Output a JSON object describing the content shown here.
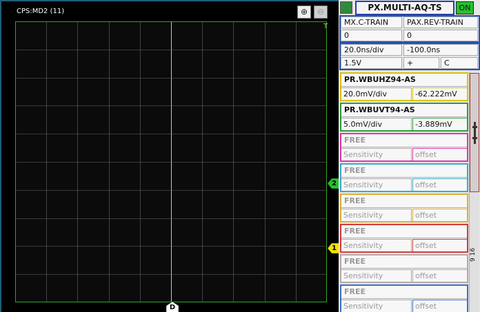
{
  "scope": {
    "title": "CPS:MD2 (11)",
    "trigger_label": "T",
    "zoom_in_icon": "zoom-in-icon",
    "zoom_out_icon": "zoom-out-icon",
    "markers": [
      {
        "label": "2",
        "color": "#22c32b"
      },
      {
        "label": "1",
        "color": "#f0e000"
      }
    ],
    "delay_marker": "D",
    "grid_color": "#2fa32f",
    "inner_grid_color": "#6a6a6a",
    "center_line_color": "#c9c9c9"
  },
  "panel": {
    "title": "PX.MULTI-AQ-TS",
    "status": "ON",
    "status_color": "#22c32b",
    "trigger_a": "MX.C-TRAIN",
    "trigger_b": "PAX.REV-TRAIN",
    "count_a": "0",
    "count_b": "0",
    "timebase": "20.0ns/div",
    "delay": "-100.0ns",
    "trig_level": "1.5V",
    "trig_slope": "+",
    "trig_coupling": "C",
    "page_indicator": "9 16"
  },
  "channels": [
    {
      "name": "PR.WBUHZ94-AS",
      "sensitivity": "20.0mV/div",
      "offset": "-62.222mV",
      "color": "#e0c000",
      "active": true
    },
    {
      "name": "PR.WBUVT94-AS",
      "sensitivity": "5.0mV/div",
      "offset": "-3.889mV",
      "color": "#2f9e3a",
      "active": true
    },
    {
      "name": "FREE",
      "sensitivity": "Sensitivity",
      "offset": "offset",
      "color": "#d93aa8",
      "active": false
    },
    {
      "name": "FREE",
      "sensitivity": "Sensitivity",
      "offset": "offset",
      "color": "#3fa9c9",
      "active": false
    },
    {
      "name": "FREE",
      "sensitivity": "Sensitivity",
      "offset": "offset",
      "color": "#e0b030",
      "active": false
    },
    {
      "name": "FREE",
      "sensitivity": "Sensitivity",
      "offset": "offset",
      "color": "#d23b3b",
      "active": false
    },
    {
      "name": "FREE",
      "sensitivity": "Sensitivity",
      "offset": "offset",
      "color": "#b9a9a9",
      "active": false
    },
    {
      "name": "FREE",
      "sensitivity": "Sensitivity",
      "offset": "offset",
      "color": "#3f6fc9",
      "active": false
    }
  ]
}
